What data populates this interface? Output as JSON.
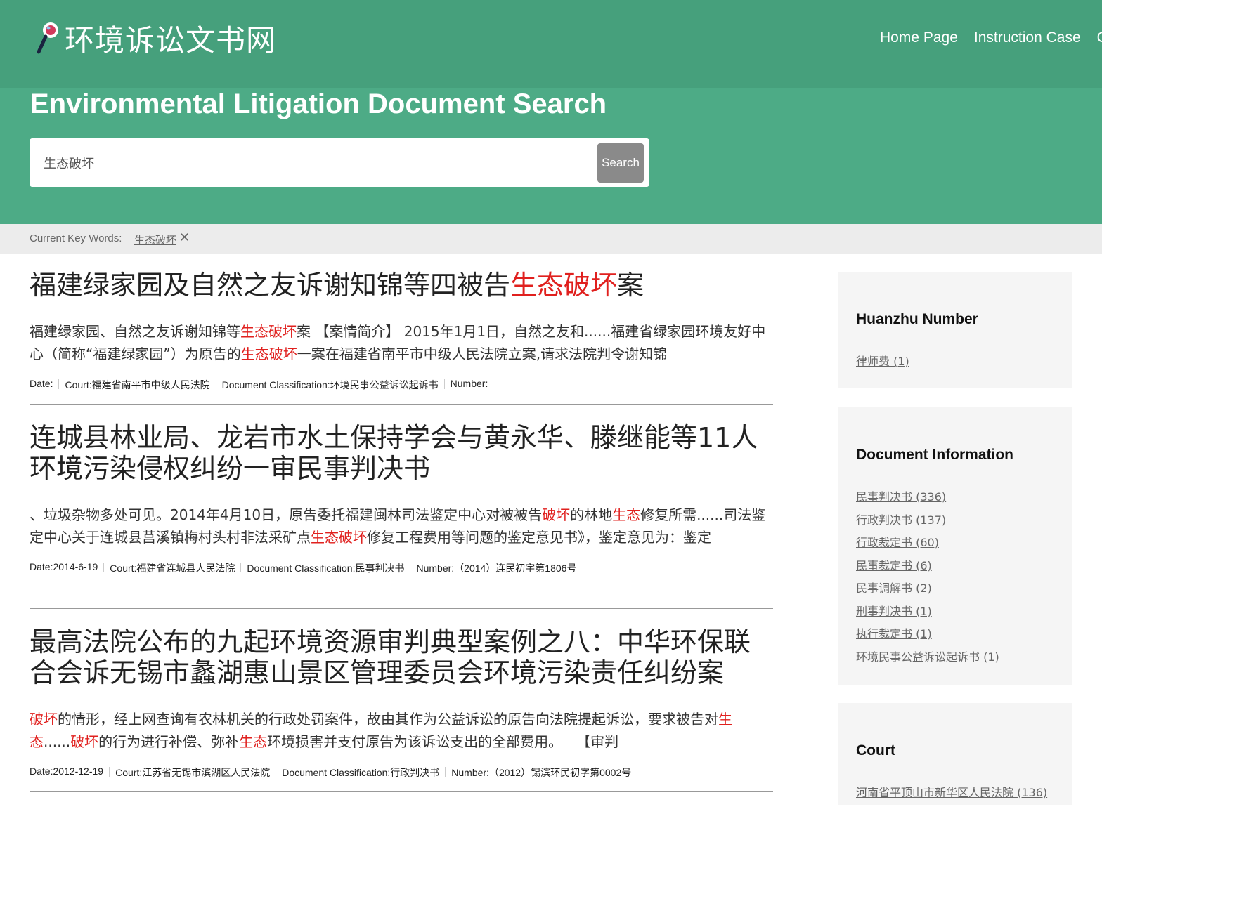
{
  "header": {
    "logo_text": "环境诉讼文书网",
    "nav": [
      "Home Page",
      "Instruction Case",
      "C"
    ]
  },
  "hero": {
    "title": "Environmental Litigation Document Search",
    "search_value": "生态破坏",
    "search_button": "Search"
  },
  "keybar": {
    "label": "Current Key Words:",
    "keyword": "生态破坏",
    "remove": "✕"
  },
  "results": [
    {
      "title": [
        {
          "t": "福建绿家园及自然之友诉谢知锦等四被告"
        },
        {
          "t": "生态破坏",
          "hl": true
        },
        {
          "t": "案"
        }
      ],
      "snippet": [
        {
          "t": "福建绿家园、自然之友诉谢知锦等"
        },
        {
          "t": "生态破坏",
          "hl": true
        },
        {
          "t": "案 【案情简介】 2015年1月1日，自然之友和......福建省绿家园环境友好中心（简称“福建绿家园”）为原告的"
        },
        {
          "t": "生态破坏",
          "hl": true
        },
        {
          "t": "一案在福建省南平市中级人民法院立案,请求法院判令谢知锦"
        }
      ],
      "meta": [
        "Date:",
        "Court:福建省南平市中级人民法院",
        "Document Classification:环境民事公益诉讼起诉书",
        "Number:"
      ]
    },
    {
      "title": [
        {
          "t": "连城县林业局、龙岩市水土保持学会与黄永华、滕继能等11人环境污染侵权纠纷一审民事判决书"
        }
      ],
      "snippet": [
        {
          "t": "、垃圾杂物多处可见。2014年4月10日，原告委托福建闽林司法鉴定中心对被被告"
        },
        {
          "t": "破坏",
          "hl": true
        },
        {
          "t": "的林地"
        },
        {
          "t": "生态",
          "hl": true
        },
        {
          "t": "修复所需......司法鉴定中心关于连城县莒溪镇梅村头村非法采矿点"
        },
        {
          "t": "生态破坏",
          "hl": true
        },
        {
          "t": "修复工程费用等问题的鉴定意见书》，鉴定意见为：鉴定"
        }
      ],
      "meta": [
        "Date:2014-6-19",
        "Court:福建省连城县人民法院",
        "Document Classification:民事判决书",
        "Number:（2014）连民初字第1806号"
      ]
    },
    {
      "title": [
        {
          "t": "最高法院公布的九起环境资源审判典型案例之八：中华环保联合会诉无锡市蠡湖惠山景区管理委员会环境污染责任纠纷案"
        }
      ],
      "snippet": [
        {
          "t": "破坏",
          "hl": true
        },
        {
          "t": "的情形，经上网查询有农林机关的行政处罚案件，故由其作为公益诉讼的原告向法院提起诉讼，要求被告对"
        },
        {
          "t": "生态",
          "hl": true
        },
        {
          "t": "......"
        },
        {
          "t": "破坏",
          "hl": true
        },
        {
          "t": "的行为进行补偿、弥补"
        },
        {
          "t": "生态",
          "hl": true
        },
        {
          "t": "环境损害并支付原告为该诉讼支出的全部费用。　　【审判"
        }
      ],
      "meta": [
        "Date:2012-12-19",
        "Court:江苏省无锡市滨湖区人民法院",
        "Document Classification:行政判决书",
        "Number:（2012）锡滨环民初字第0002号"
      ]
    }
  ],
  "sidebar": {
    "panels": [
      {
        "title": "Huanzhu Number",
        "links": [
          "律师费 (1)"
        ]
      },
      {
        "title": "Document Information",
        "links": [
          "民事判决书 (336)",
          "行政判决书 (137)",
          "行政裁定书 (60)",
          "民事裁定书 (6)",
          "民事调解书 (2)",
          "刑事判决书 (1)",
          "执行裁定书 (1)",
          "环境民事公益诉讼起诉书 (1)"
        ]
      },
      {
        "title": "Court",
        "links": [
          "河南省平顶山市新华区人民法院 (136)"
        ]
      }
    ]
  },
  "colors": {
    "header_bg": "#46a07c",
    "hero_bg": "#4dab86",
    "highlight": "#e0201e",
    "keybar_bg": "#ececec",
    "panel_bg": "#f5f5f5"
  }
}
